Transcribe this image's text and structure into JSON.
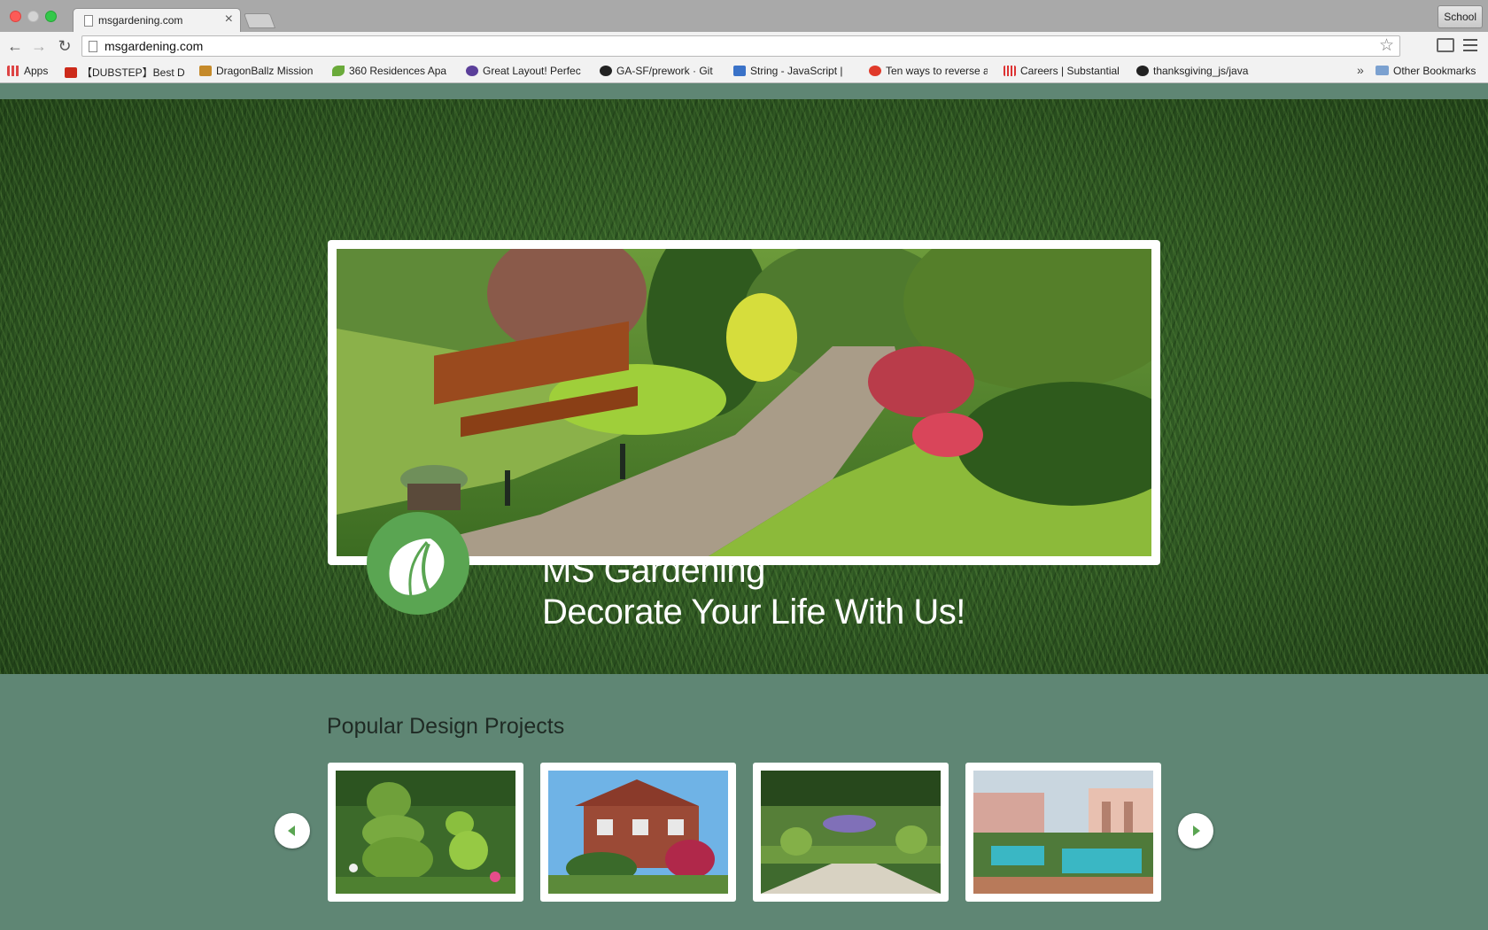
{
  "browser": {
    "tab_title": "msgardening.com",
    "tab_close": "×",
    "profile": "School",
    "url": "msgardening.com",
    "bookmarks": [
      {
        "label": "Apps",
        "icon": "apps-grid-icon",
        "color": "#d44"
      },
      {
        "label": "【DUBSTEP】Best D",
        "icon": "youtube-icon",
        "color": "#cc2a1a"
      },
      {
        "label": "DragonBallz Mission",
        "icon": "dbz-icon",
        "color": "#c58a2a"
      },
      {
        "label": "360 Residences Apa",
        "icon": "leaf-icon",
        "color": "#6aaa3a"
      },
      {
        "label": "Great Layout! Perfec",
        "icon": "peace-icon",
        "color": "#5b3f9a"
      },
      {
        "label": "GA-SF/prework · Git",
        "icon": "github-icon",
        "color": "#222"
      },
      {
        "label": "String - JavaScript |",
        "icon": "mdn-icon",
        "color": "#3a72c8"
      },
      {
        "label": "Ten ways to reverse a",
        "icon": "star-badge-icon",
        "color": "#e03a2a"
      },
      {
        "label": "Careers | Substantial",
        "icon": "substantial-icon",
        "color": "#d33"
      },
      {
        "label": "thanksgiving_js/java",
        "icon": "github-icon",
        "color": "#222"
      }
    ],
    "more": "»",
    "other_bookmarks": "Other Bookmarks"
  },
  "page": {
    "brand_title": "MS Gardening",
    "brand_tagline": "Decorate Your Life With Us!",
    "section_title": "Popular Design Projects",
    "accent_color": "#5aa552",
    "background_color": "#5f8674",
    "projects": [
      {
        "name": "topiary-garden"
      },
      {
        "name": "brick-house"
      },
      {
        "name": "formal-garden"
      },
      {
        "name": "pool-garden"
      }
    ]
  }
}
